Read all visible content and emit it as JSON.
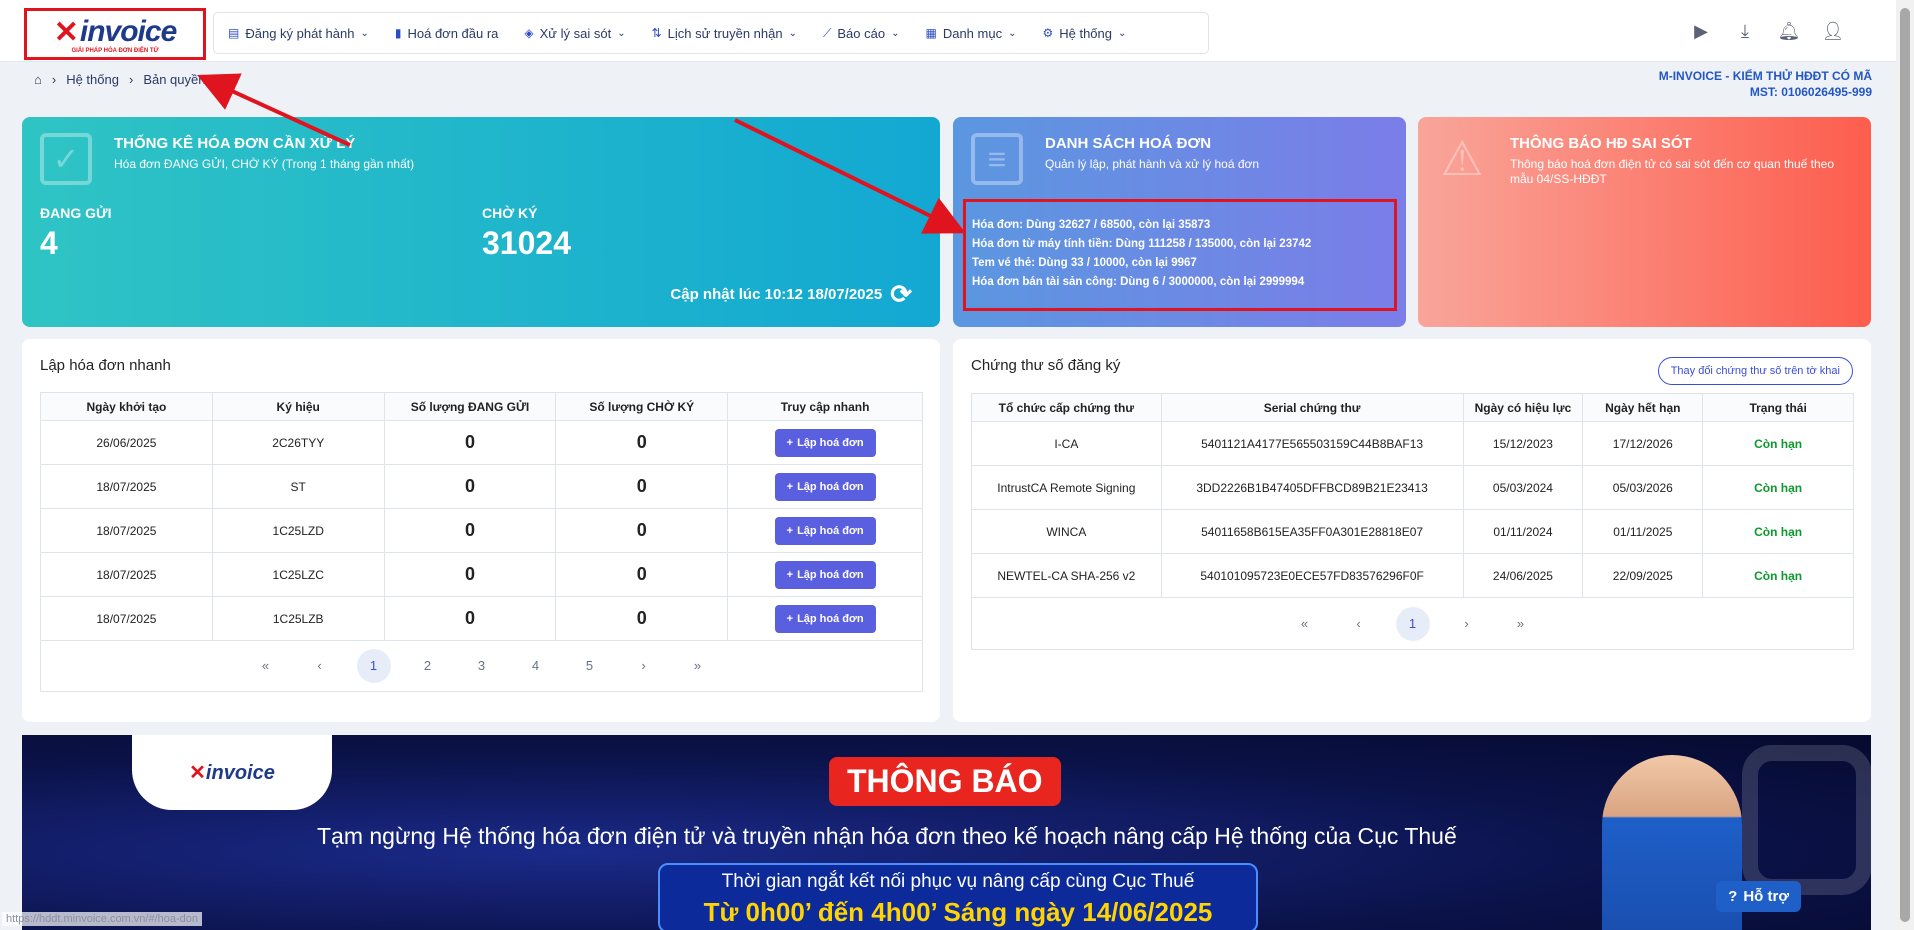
{
  "logo": {
    "text": "invoice",
    "tagline": "GIẢI PHÁP HÓA ĐƠN ĐIỆN TỬ"
  },
  "nav": [
    {
      "label": "Đăng ký phát hành",
      "icon": "file-edit-icon",
      "dropdown": true
    },
    {
      "label": "Hoá đơn đầu ra",
      "icon": "document-icon",
      "dropdown": false
    },
    {
      "label": "Xử lý sai sót",
      "icon": "alert-icon",
      "dropdown": true
    },
    {
      "label": "Lịch sử truyền nhận",
      "icon": "transfer-icon",
      "dropdown": true
    },
    {
      "label": "Báo cáo",
      "icon": "chart-icon",
      "dropdown": true
    },
    {
      "label": "Danh mục",
      "icon": "grid-icon",
      "dropdown": true
    },
    {
      "label": "Hệ thống",
      "icon": "gear-icon",
      "dropdown": true
    }
  ],
  "breadcrumb": {
    "items": [
      "Hệ thống",
      "Bản quyền"
    ]
  },
  "company": {
    "name": "M-INVOICE - KIỂM THỬ HĐĐT CÓ MÃ",
    "mst": "MST: 0106026495-999"
  },
  "card_stats": {
    "title": "THỐNG KÊ HÓA ĐƠN CẦN XỬ LÝ",
    "subtitle": "Hóa đơn ĐANG GỬI, CHỜ KÝ (Trong 1 tháng gần nhất)",
    "sending_label": "ĐANG GỬI",
    "sending_value": "4",
    "pending_label": "CHỜ KÝ",
    "pending_value": "31024",
    "updated": "Cập nhật lúc 10:12 18/07/2025"
  },
  "card_list": {
    "title": "DANH SÁCH HOÁ ĐƠN",
    "subtitle": "Quản lý lập, phát hành và xử lý hoá đơn",
    "lines": [
      "Hóa đơn: Dùng 32627 / 68500, còn lại 35873",
      "Hóa đơn từ máy tính tiền: Dùng 111258 / 135000, còn lại 23742",
      "Tem vé thẻ: Dùng 33 / 10000, còn lại 9967",
      "Hóa đơn bán tài sản công: Dùng 6 / 3000000, còn lại 2999994"
    ]
  },
  "card_errors": {
    "title": "THÔNG BÁO HĐ SAI SÓT",
    "subtitle": "Thông báo hoá đơn điện tử có sai sót đến cơ quan thuế theo mẫu 04/SS-HĐĐT"
  },
  "quick": {
    "title": "Lập hóa đơn nhanh",
    "headers": [
      "Ngày khởi tạo",
      "Ký hiệu",
      "Số lượng ĐANG GỬI",
      "Số lượng CHỜ KÝ",
      "Truy cập nhanh"
    ],
    "button_label": "Lập hoá đơn",
    "rows": [
      {
        "date": "26/06/2025",
        "code": "2C26TYY",
        "sending": "0",
        "pending": "0"
      },
      {
        "date": "18/07/2025",
        "code": "ST",
        "sending": "0",
        "pending": "0"
      },
      {
        "date": "18/07/2025",
        "code": "1C25LZD",
        "sending": "0",
        "pending": "0"
      },
      {
        "date": "18/07/2025",
        "code": "1C25LZC",
        "sending": "0",
        "pending": "0"
      },
      {
        "date": "18/07/2025",
        "code": "1C25LZB",
        "sending": "0",
        "pending": "0"
      }
    ],
    "pages": [
      "1",
      "2",
      "3",
      "4",
      "5"
    ],
    "current_page": "1"
  },
  "certs": {
    "title": "Chứng thư số đăng ký",
    "change_button": "Thay đổi chứng thư số trên tờ khai",
    "headers": [
      "Tổ chức cấp chứng thư",
      "Serial chứng thư",
      "Ngày có hiệu lực",
      "Ngày hết hạn",
      "Trạng thái"
    ],
    "rows": [
      {
        "org": "I-CA",
        "serial": "5401121A4177E565503159C44B8BAF13",
        "from": "15/12/2023",
        "to": "17/12/2026",
        "status": "Còn hạn"
      },
      {
        "org": "IntrustCA Remote Signing",
        "serial": "3DD2226B1B47405DFFBCD89B21E23413",
        "from": "05/03/2024",
        "to": "05/03/2026",
        "status": "Còn hạn"
      },
      {
        "org": "WINCA",
        "serial": "54011658B615EA35FF0A301E28818E07",
        "from": "01/11/2024",
        "to": "01/11/2025",
        "status": "Còn hạn"
      },
      {
        "org": "NEWTEL-CA SHA-256 v2",
        "serial": "540101095723E0ECE57FD83576296F0F",
        "from": "24/06/2025",
        "to": "22/09/2025",
        "status": "Còn hạn"
      }
    ],
    "pages": [
      "1"
    ],
    "current_page": "1"
  },
  "banner": {
    "logo_text": "invoice",
    "title": "THÔNG BÁO",
    "line": "Tạm ngừng Hệ thống hóa đơn điện tử và truyền nhận hóa đơn theo kế hoạch nâng cấp Hệ thống của Cục Thuế",
    "box_line1": "Thời gian ngắt kết nối phục vụ nâng cấp cùng Cục Thuế",
    "box_line2": "Từ 0h00’ đến 4h00’ Sáng ngày 14/06/2025"
  },
  "help": {
    "label": "Hỗ trợ"
  },
  "status_url": "https://hddt.minvoice.com.vn/#/hoa-don",
  "colors": {
    "accent": "#5a5fe0",
    "highlight": "#e0141e",
    "ok": "#0a9b2c"
  }
}
